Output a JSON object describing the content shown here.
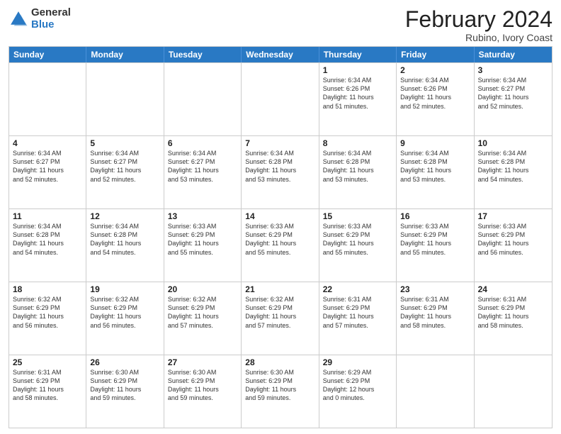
{
  "logo": {
    "general": "General",
    "blue": "Blue"
  },
  "calendar": {
    "title": "February 2024",
    "subtitle": "Rubino, Ivory Coast",
    "headers": [
      "Sunday",
      "Monday",
      "Tuesday",
      "Wednesday",
      "Thursday",
      "Friday",
      "Saturday"
    ],
    "weeks": [
      [
        {
          "day": "",
          "info": ""
        },
        {
          "day": "",
          "info": ""
        },
        {
          "day": "",
          "info": ""
        },
        {
          "day": "",
          "info": ""
        },
        {
          "day": "1",
          "info": "Sunrise: 6:34 AM\nSunset: 6:26 PM\nDaylight: 11 hours\nand 51 minutes."
        },
        {
          "day": "2",
          "info": "Sunrise: 6:34 AM\nSunset: 6:26 PM\nDaylight: 11 hours\nand 52 minutes."
        },
        {
          "day": "3",
          "info": "Sunrise: 6:34 AM\nSunset: 6:27 PM\nDaylight: 11 hours\nand 52 minutes."
        }
      ],
      [
        {
          "day": "4",
          "info": "Sunrise: 6:34 AM\nSunset: 6:27 PM\nDaylight: 11 hours\nand 52 minutes."
        },
        {
          "day": "5",
          "info": "Sunrise: 6:34 AM\nSunset: 6:27 PM\nDaylight: 11 hours\nand 52 minutes."
        },
        {
          "day": "6",
          "info": "Sunrise: 6:34 AM\nSunset: 6:27 PM\nDaylight: 11 hours\nand 53 minutes."
        },
        {
          "day": "7",
          "info": "Sunrise: 6:34 AM\nSunset: 6:28 PM\nDaylight: 11 hours\nand 53 minutes."
        },
        {
          "day": "8",
          "info": "Sunrise: 6:34 AM\nSunset: 6:28 PM\nDaylight: 11 hours\nand 53 minutes."
        },
        {
          "day": "9",
          "info": "Sunrise: 6:34 AM\nSunset: 6:28 PM\nDaylight: 11 hours\nand 53 minutes."
        },
        {
          "day": "10",
          "info": "Sunrise: 6:34 AM\nSunset: 6:28 PM\nDaylight: 11 hours\nand 54 minutes."
        }
      ],
      [
        {
          "day": "11",
          "info": "Sunrise: 6:34 AM\nSunset: 6:28 PM\nDaylight: 11 hours\nand 54 minutes."
        },
        {
          "day": "12",
          "info": "Sunrise: 6:34 AM\nSunset: 6:28 PM\nDaylight: 11 hours\nand 54 minutes."
        },
        {
          "day": "13",
          "info": "Sunrise: 6:33 AM\nSunset: 6:29 PM\nDaylight: 11 hours\nand 55 minutes."
        },
        {
          "day": "14",
          "info": "Sunrise: 6:33 AM\nSunset: 6:29 PM\nDaylight: 11 hours\nand 55 minutes."
        },
        {
          "day": "15",
          "info": "Sunrise: 6:33 AM\nSunset: 6:29 PM\nDaylight: 11 hours\nand 55 minutes."
        },
        {
          "day": "16",
          "info": "Sunrise: 6:33 AM\nSunset: 6:29 PM\nDaylight: 11 hours\nand 55 minutes."
        },
        {
          "day": "17",
          "info": "Sunrise: 6:33 AM\nSunset: 6:29 PM\nDaylight: 11 hours\nand 56 minutes."
        }
      ],
      [
        {
          "day": "18",
          "info": "Sunrise: 6:32 AM\nSunset: 6:29 PM\nDaylight: 11 hours\nand 56 minutes."
        },
        {
          "day": "19",
          "info": "Sunrise: 6:32 AM\nSunset: 6:29 PM\nDaylight: 11 hours\nand 56 minutes."
        },
        {
          "day": "20",
          "info": "Sunrise: 6:32 AM\nSunset: 6:29 PM\nDaylight: 11 hours\nand 57 minutes."
        },
        {
          "day": "21",
          "info": "Sunrise: 6:32 AM\nSunset: 6:29 PM\nDaylight: 11 hours\nand 57 minutes."
        },
        {
          "day": "22",
          "info": "Sunrise: 6:31 AM\nSunset: 6:29 PM\nDaylight: 11 hours\nand 57 minutes."
        },
        {
          "day": "23",
          "info": "Sunrise: 6:31 AM\nSunset: 6:29 PM\nDaylight: 11 hours\nand 58 minutes."
        },
        {
          "day": "24",
          "info": "Sunrise: 6:31 AM\nSunset: 6:29 PM\nDaylight: 11 hours\nand 58 minutes."
        }
      ],
      [
        {
          "day": "25",
          "info": "Sunrise: 6:31 AM\nSunset: 6:29 PM\nDaylight: 11 hours\nand 58 minutes."
        },
        {
          "day": "26",
          "info": "Sunrise: 6:30 AM\nSunset: 6:29 PM\nDaylight: 11 hours\nand 59 minutes."
        },
        {
          "day": "27",
          "info": "Sunrise: 6:30 AM\nSunset: 6:29 PM\nDaylight: 11 hours\nand 59 minutes."
        },
        {
          "day": "28",
          "info": "Sunrise: 6:30 AM\nSunset: 6:29 PM\nDaylight: 11 hours\nand 59 minutes."
        },
        {
          "day": "29",
          "info": "Sunrise: 6:29 AM\nSunset: 6:29 PM\nDaylight: 12 hours\nand 0 minutes."
        },
        {
          "day": "",
          "info": ""
        },
        {
          "day": "",
          "info": ""
        }
      ]
    ]
  }
}
